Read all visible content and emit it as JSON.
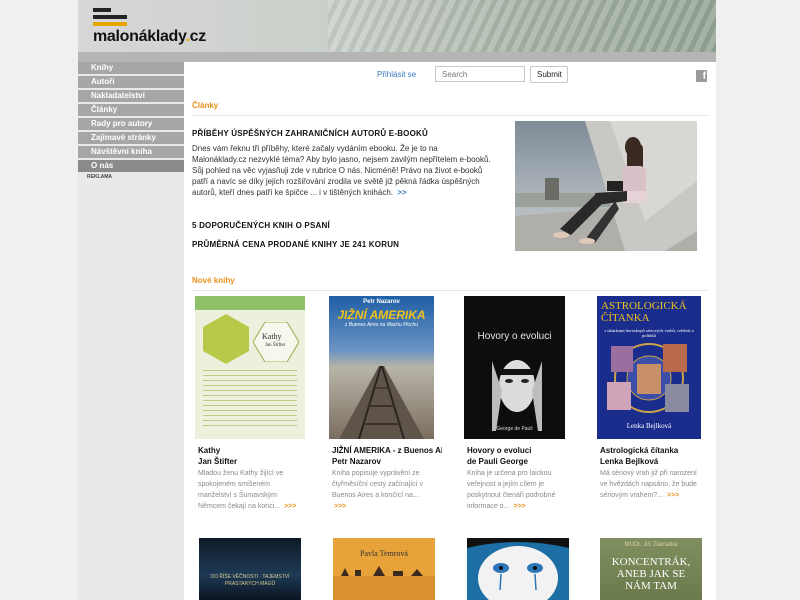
{
  "site": {
    "logo_main": "malonáklady",
    "logo_dot": ".",
    "logo_tld": "cz"
  },
  "nav": {
    "items": [
      {
        "label": "Knihy"
      },
      {
        "label": "Autoři"
      },
      {
        "label": "Nakladatelství"
      },
      {
        "label": "Články"
      },
      {
        "label": "Rady pro autory"
      },
      {
        "label": "Zajímavé stránky"
      },
      {
        "label": "Návštěvní kniha"
      },
      {
        "label": "O nás"
      }
    ],
    "reklama": "REKLAMA"
  },
  "topbar": {
    "login_label": "Přihlásit se",
    "search_placeholder": "Search",
    "submit_label": "Submit",
    "fb_glyph": "f"
  },
  "articles": {
    "section_title": "Články",
    "main_title": "PŘÍBĚHY ÚSPĚŠNÝCH ZAHRANIČNÍCH AUTORŮ E-BOOKŮ",
    "main_text": "Dnes vám řeknu tři příběhy, které začaly vydáním ebooku. Že je to na Malonáklady.cz nezvyklé téma? Aby bylo jasno, nejsem zavilým nepřítelem e-booků. Sůj pohled na věc vyjasňuji zde v rubrice O nás. Nicméně! Právo na život e-booků patří a navíc se díky jejich rozšiřování zrodila ve světě již pěkná řádka úspěšných autorů, kteří dnes patří ke špičce ... i v tištěných knihách.",
    "more": ">>",
    "link1": "5 DOPORUČENÝCH KNIH O PSANÍ",
    "link2": "PRŮMĚRNÁ CENA PRODANÉ KNIHY JE 241 KORUN"
  },
  "new_books": {
    "section_title": "Nové knihy",
    "books": [
      {
        "title1": "Kathy",
        "title2": "Jan Štifter",
        "desc": "Mladou ženu Kathy žijící ve spokojeném smíšeném manželství s Šumavským Němcem čekají na konci...",
        "more": ">>>",
        "cover_title": "Kathy",
        "cover_author": "Jan Štifter"
      },
      {
        "title1": "JIŽNÍ AMERIKA - z Buenos Aires na Machu...",
        "title2": "Petr Nazarov",
        "desc": "Kniha popisuje vyprávění ze čtyřměsíční cesty začínající v Buenos Aires a končící na...",
        "more": ">>>",
        "cover_author": "Petr Nazarov",
        "cover_title": "JIŽNÍ AMERIKA",
        "cover_subtitle": "z Buenos Aires na Machu Picchu"
      },
      {
        "title1": "Hovory o evoluci",
        "title2": "de Pauli George",
        "desc": "Kniha je určena pro laickou veřejnost a jejím cílem je poskytnout čtenáři podrobné informace o...",
        "more": ">>>",
        "cover_title": "Hovory o evoluci",
        "cover_author": "George de Pauli"
      },
      {
        "title1": "Astrologická čítanka",
        "title2": "Lenka Bejlková",
        "desc": "Má sériový vrah již při narození ve hvězdách napsáno, že bude sériovým vrahem?...",
        "more": ">>>",
        "cover_title": "ASTROLOGICKÁ ČÍTANKA",
        "cover_subtitle": "s ukázkami horoskopů sériových vrahů, celebrit a politiků",
        "cover_author": "Lenka Bejlková"
      }
    ],
    "row2": [
      {
        "cover_text": "DO ŘÍŠE VĚČNOSTI · TAJEMSTVÍ PRASTARÝCH MÁGŮ"
      },
      {
        "cover_text": "Pavla Temrová"
      },
      {
        "cover_text": ""
      },
      {
        "cover_author": "MUDr. Jiří Zlámatka",
        "cover_text": "KONCENTRÁK, ANEB JAK SE NÁM TAM"
      }
    ]
  },
  "colors": {
    "accent_orange": "#e8901a",
    "link_blue": "#3a7bbf",
    "nav_gray": "#a6a6a6"
  }
}
